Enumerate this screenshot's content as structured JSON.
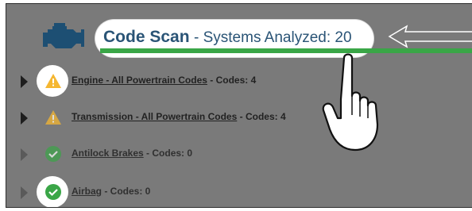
{
  "header": {
    "title": "Code Scan",
    "separator": " - ",
    "subtitle": "Systems Analyzed: 20",
    "progress": 1.0,
    "progress_color": "#3aa647",
    "title_color": "#2a5476",
    "icon": "engine-icon"
  },
  "systems": [
    {
      "name": "Engine - All Powertrain Codes",
      "suffix": " - Codes: 4",
      "status": "warning",
      "expandable": true,
      "highlighted": true
    },
    {
      "name": "Transmission - All Powertrain Codes",
      "suffix": " - Codes: 4",
      "status": "warning",
      "expandable": true,
      "highlighted": false
    },
    {
      "name": "Antilock Brakes",
      "suffix": " - Codes: 0",
      "status": "ok",
      "expandable": true,
      "highlighted": false
    },
    {
      "name": "Airbag",
      "suffix": " - Codes: 0",
      "status": "ok",
      "expandable": true,
      "highlighted": true
    }
  ],
  "colors": {
    "overlay": "#7a7a7a",
    "warning": "#f5b731",
    "ok": "#3aa647"
  },
  "annotations": {
    "pointer": "hand-pointer-icon",
    "arrow": "arrow-left-outline-icon"
  }
}
